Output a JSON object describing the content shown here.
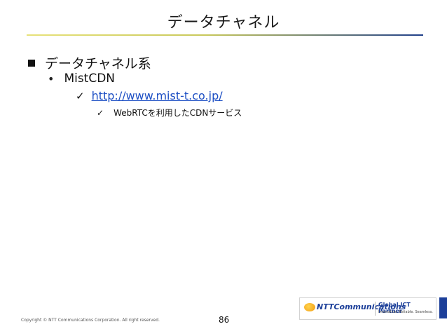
{
  "slide": {
    "title": "データチャネル",
    "bullet_l1": "データチャネル系",
    "bullet_l2": "MistCDN",
    "bullet_l3_link": "http://www.mist-t.co.jp/",
    "bullet_l4": "WebRTCを利用したCDNサービス"
  },
  "footer": {
    "copyright": "Copyright © NTT Communications Corporation. All right reserved.",
    "page_number": "86"
  },
  "logo": {
    "company": "NTTCommunications",
    "partner": "Global ICT Partner",
    "tagline": "Innovative. Reliable. Seamless."
  },
  "colors": {
    "link": "#1d4fc4",
    "brand_blue": "#1c3f99",
    "rule_start": "#e7e27a",
    "rule_end": "#1f3f8a"
  }
}
